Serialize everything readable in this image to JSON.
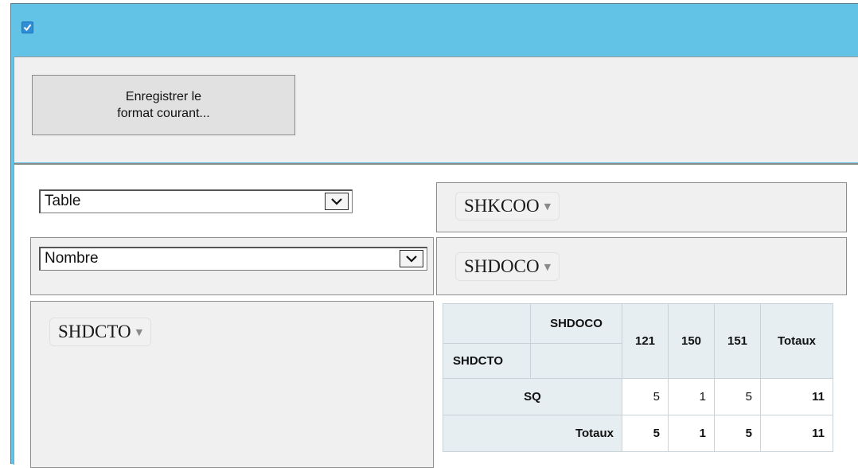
{
  "toolbar": {
    "save_label": "Enregistrer le\nformat courant..."
  },
  "controls": {
    "renderer_select": "Table",
    "aggregator_select": "Nombre"
  },
  "fields": {
    "unused": "SHKCOO",
    "column": "SHDOCO",
    "row": "SHDCTO"
  },
  "pivot": {
    "col_attr": "SHDOCO",
    "row_attr": "SHDCTO",
    "col_headers": [
      "121",
      "150",
      "151"
    ],
    "totals_label": "Totaux",
    "rows": [
      {
        "label": "SQ",
        "values": [
          "5",
          "1",
          "5"
        ],
        "total": "11"
      }
    ],
    "col_totals": [
      "5",
      "1",
      "5"
    ],
    "grand_total": "11"
  },
  "colors": {
    "titlebar": "#62c3e6",
    "header_cell": "#e6eef2",
    "panel": "#f0f0f0"
  },
  "icons": {
    "app": "app-check-icon",
    "dropdown": "chevron-down-icon",
    "pill_caret": "triangle-down-icon"
  }
}
